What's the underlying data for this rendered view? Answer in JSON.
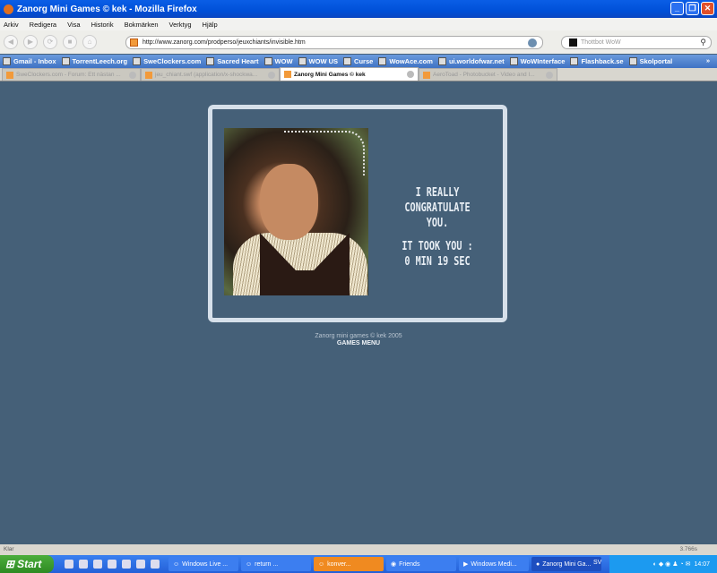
{
  "window": {
    "title": "Zanorg Mini Games © kek - Mozilla Firefox"
  },
  "menu": [
    "Arkiv",
    "Redigera",
    "Visa",
    "Historik",
    "Bokmärken",
    "Verktyg",
    "Hjälp"
  ],
  "nav": {
    "url": "http://www.zanorg.com/prodperso/jeuxchiants/invisible.htm",
    "search_placeholder": "Thottbot WoW"
  },
  "bookmarks": [
    "Gmail - Inbox",
    "TorrentLeech.org",
    "SweClockers.com",
    "Sacred Heart",
    "WOW",
    "WOW US",
    "Curse",
    "WowAce.com",
    "ui.worldofwar.net",
    "WoWInterface",
    "Flashback.se",
    "Skolportal"
  ],
  "bookmarks_more": "»",
  "tabs": [
    {
      "label": "SweClockers.com - Forum: Ett nästan ...",
      "active": false
    },
    {
      "label": "jeu_chiant.swf (application/x-shockwa...",
      "active": false
    },
    {
      "label": "Zanorg Mini Games © kek",
      "active": true
    },
    {
      "label": "AeroToad - Photobucket - Video and I...",
      "active": false
    }
  ],
  "page": {
    "line1": "I REALLY",
    "line2": "CONGRATULATE YOU.",
    "line3": "IT TOOK YOU :",
    "line4": "0 MIN 19 SEC",
    "copyright": "Zanorg mini games © kek 2005",
    "games_menu": "GAMES MENU",
    "background": "#456078"
  },
  "status": {
    "text": "Klar",
    "timer": "3.766s"
  },
  "taskbar": {
    "start": "Start",
    "buttons": [
      "Windows Live ...",
      "return ...",
      "konver...",
      "Friends",
      "Windows Medi...",
      "Zanorg Mini Ga..."
    ],
    "lang": "SV",
    "clock": "14:07"
  }
}
